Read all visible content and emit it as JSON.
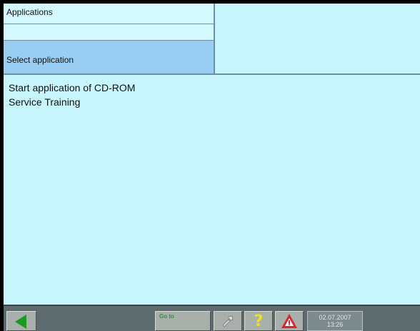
{
  "header": {
    "title": "Applications",
    "select_label": "Select application"
  },
  "applications": [
    {
      "label": "Start application of CD-ROM"
    },
    {
      "label": "Service Training"
    }
  ],
  "toolbar": {
    "goto_label": "Go to",
    "help_glyph": "?",
    "date": "02.07.2007",
    "time": "13:26"
  },
  "icons": {
    "back": "back-arrow-icon",
    "tools": "tools-icon",
    "help": "help-icon",
    "warning": "warning-icon"
  },
  "colors": {
    "background": "#c8f6fd",
    "select_bar": "#99cdf2",
    "toolbar": "#5d6a6e",
    "back_arrow": "#1c9a1e",
    "help": "#f0e022",
    "warning": "#d9252a"
  }
}
